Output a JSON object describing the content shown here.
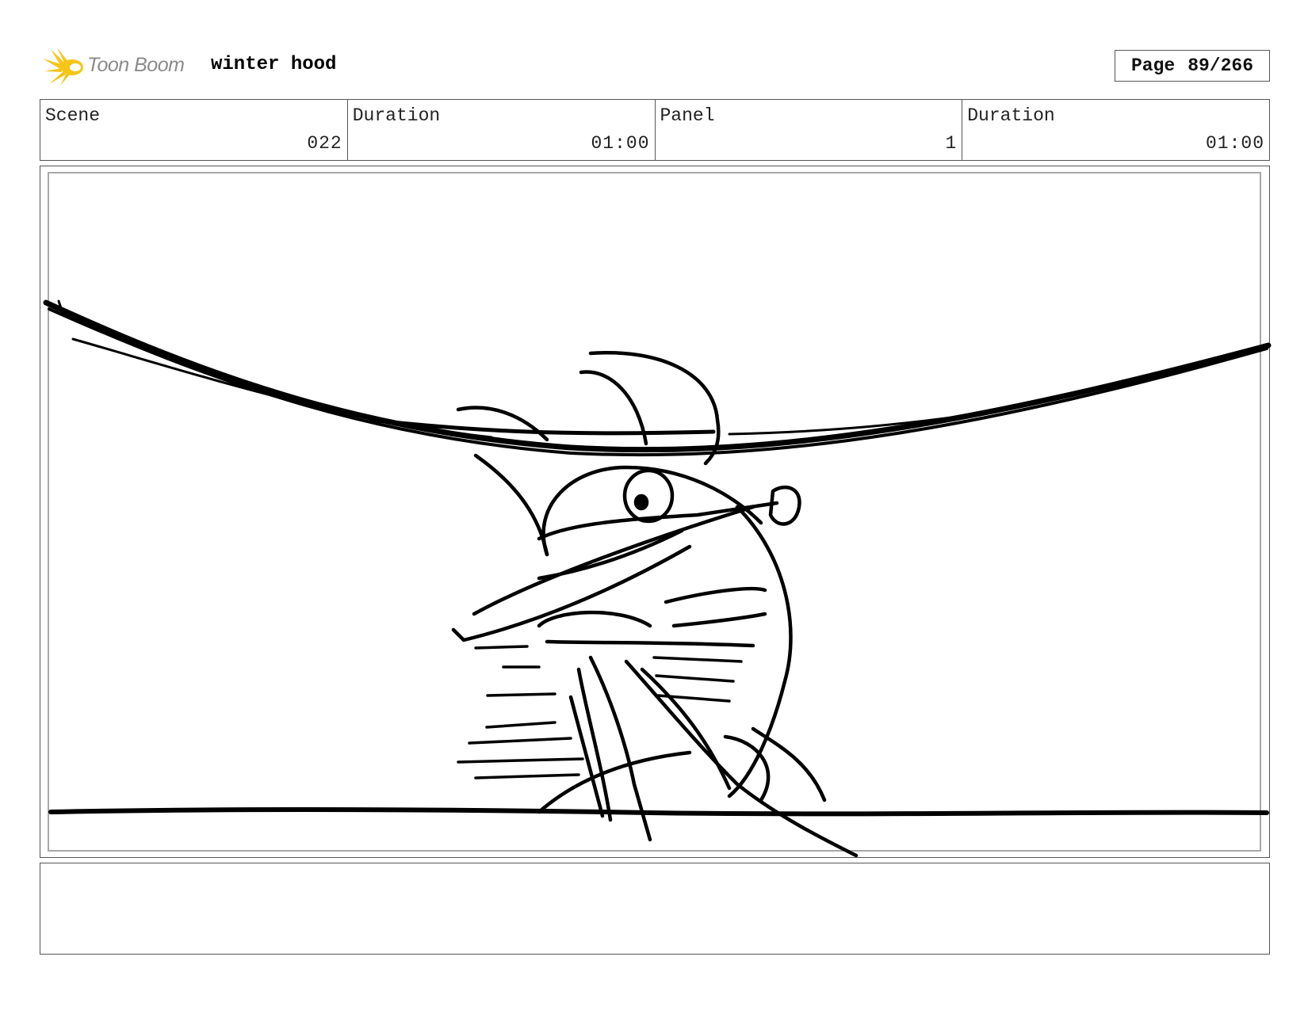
{
  "header": {
    "logo_text": "Toon Boom",
    "project_title": "winter hood",
    "page_label": "Page",
    "page_number": "89/266"
  },
  "info": {
    "scene_label": "Scene",
    "scene_value": "022",
    "scene_duration_label": "Duration",
    "scene_duration_value": "01:00",
    "panel_label": "Panel",
    "panel_value": "1",
    "panel_duration_label": "Duration",
    "panel_duration_value": "01:00"
  },
  "colors": {
    "logo_yellow": "#f5c518",
    "logo_text": "#8a8a8a",
    "border": "#555555",
    "panel_frame": "#a8a8a8",
    "ink": "#000000"
  },
  "icons": {
    "logo": "toon-boom-burst-icon"
  },
  "notes": {
    "text": ""
  }
}
